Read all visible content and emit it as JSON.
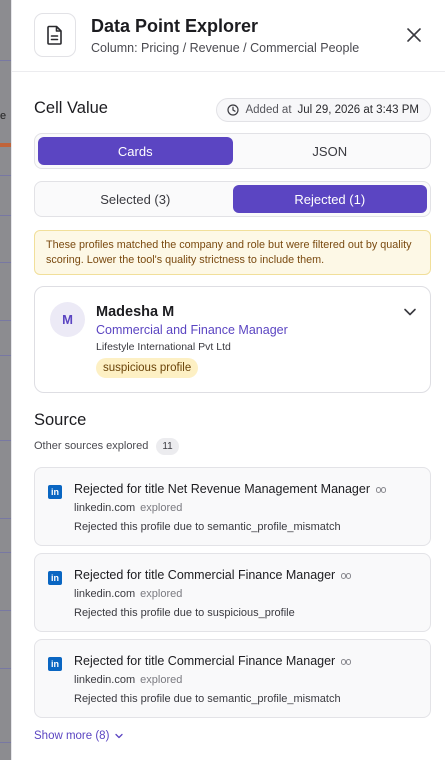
{
  "backdrop": {
    "fragment": "e"
  },
  "header": {
    "title": "Data Point Explorer",
    "subtitle": "Column: Pricing / Revenue / Commercial People",
    "icon": "document-icon",
    "close_icon": "close-icon"
  },
  "cell": {
    "label": "Cell Value",
    "added_label": "Added at",
    "added_value": "Jul 29, 2026 at 3:43 PM"
  },
  "view_tabs": {
    "cards": "Cards",
    "json": "JSON",
    "active": "Cards"
  },
  "filter_tabs": {
    "selected": "Selected (3)",
    "rejected": "Rejected (1)",
    "active": "Rejected (1)"
  },
  "warning": "These profiles matched the company and role but were filtered out by quality scoring. Lower the tool's quality strictness to include them.",
  "profile": {
    "initial": "M",
    "name": "Madesha M",
    "role": "Commercial and Finance Manager",
    "company": "Lifestyle International Pvt Ltd",
    "badge": "suspicious profile"
  },
  "source": {
    "title": "Source",
    "other_label": "Other sources explored",
    "other_count": "11",
    "cards": [
      {
        "title": "Rejected for title Net Revenue Management Manager",
        "domain": "linkedin.com",
        "status": "explored",
        "reason": "Rejected this profile due to semantic_profile_mismatch"
      },
      {
        "title": "Rejected for title Commercial Finance Manager",
        "domain": "linkedin.com",
        "status": "explored",
        "reason": "Rejected this profile due to suspicious_profile"
      },
      {
        "title": "Rejected for title Commercial Finance Manager",
        "domain": "linkedin.com",
        "status": "explored",
        "reason": "Rejected this profile due to semantic_profile_mismatch"
      }
    ],
    "show_more": "Show more (8)"
  },
  "colors": {
    "accent": "#5b45c2",
    "warning_bg": "#fdf8e6",
    "linkedin": "#0a66c2"
  }
}
